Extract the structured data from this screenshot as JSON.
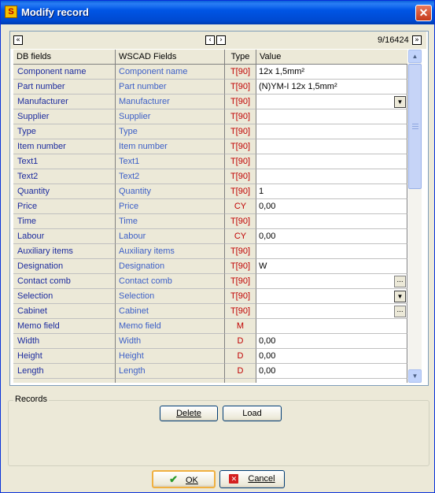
{
  "window": {
    "title": "Modify record",
    "app_icon_glyph": "S",
    "close_glyph": "✕"
  },
  "nav": {
    "first": "«",
    "prev": "‹",
    "next": "›",
    "last": "»",
    "record_counter": "9/16424"
  },
  "columns": {
    "db": "DB fields",
    "wscad": "WSCAD Fields",
    "type": "Type",
    "value": "Value"
  },
  "rows": [
    {
      "db": "Component name",
      "wscad": "Component name",
      "type": "T[90]",
      "value": "12x 1,5mm²"
    },
    {
      "db": "Part number",
      "wscad": "Part number",
      "type": "T[90]",
      "value": "(N)YM-I 12x 1,5mm²"
    },
    {
      "db": "Manufacturer",
      "wscad": "Manufacturer",
      "type": "T[90]",
      "value": ""
    },
    {
      "db": "Supplier",
      "wscad": "Supplier",
      "type": "T[90]",
      "value": ""
    },
    {
      "db": "Type",
      "wscad": "Type",
      "type": "T[90]",
      "value": ""
    },
    {
      "db": "Item number",
      "wscad": "Item number",
      "type": "T[90]",
      "value": ""
    },
    {
      "db": "Text1",
      "wscad": "Text1",
      "type": "T[90]",
      "value": ""
    },
    {
      "db": "Text2",
      "wscad": "Text2",
      "type": "T[90]",
      "value": ""
    },
    {
      "db": "Quantity",
      "wscad": "Quantity",
      "type": "T[90]",
      "value": "1"
    },
    {
      "db": "Price",
      "wscad": "Price",
      "type": "CY",
      "value": "0,00"
    },
    {
      "db": "Time",
      "wscad": "Time",
      "type": "T[90]",
      "value": ""
    },
    {
      "db": "Labour",
      "wscad": "Labour",
      "type": "CY",
      "value": "0,00"
    },
    {
      "db": "Auxiliary items",
      "wscad": "Auxiliary items",
      "type": "T[90]",
      "value": ""
    },
    {
      "db": "Designation",
      "wscad": "Designation",
      "type": "T[90]",
      "value": "W"
    },
    {
      "db": "Contact comb",
      "wscad": "Contact comb",
      "type": "T[90]",
      "value": ""
    },
    {
      "db": "Selection",
      "wscad": "Selection",
      "type": "T[90]",
      "value": ""
    },
    {
      "db": "Cabinet",
      "wscad": "Cabinet",
      "type": "T[90]",
      "value": ""
    },
    {
      "db": "Memo field",
      "wscad": "Memo field",
      "type": "M",
      "value": ""
    },
    {
      "db": "Width",
      "wscad": "Width",
      "type": "D",
      "value": "0,00"
    },
    {
      "db": "Height",
      "wscad": "Height",
      "type": "D",
      "value": "0,00"
    },
    {
      "db": "Length",
      "wscad": "Length",
      "type": "D",
      "value": "0,00"
    },
    {
      "db": "",
      "wscad": "",
      "type": "",
      "value": ""
    }
  ],
  "records": {
    "label": "Records",
    "delete": "Delete",
    "load": "Load"
  },
  "footer": {
    "ok": "OK",
    "cancel": "Cancel"
  },
  "icons": {
    "dropdown": "▼",
    "ellipsis": "...",
    "scroll_up": "▲",
    "scroll_down": "▼",
    "ok_check": "✔",
    "cancel_x": "✕"
  },
  "colors": {
    "titlebar": "#0055e5",
    "db_field": "#1c2b9e",
    "wscad_field": "#3c5fc7",
    "type": "#c00000",
    "dialog": "#ece9d8"
  }
}
